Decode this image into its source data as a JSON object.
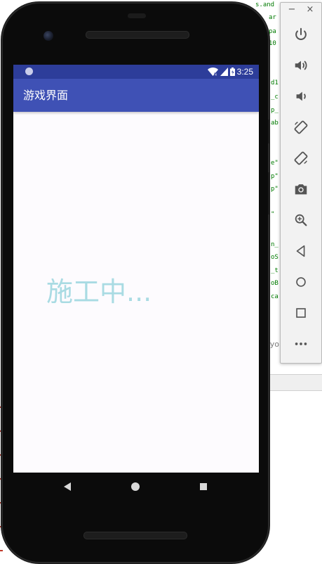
{
  "emulator": {
    "minimize_glyph": "−",
    "close_glyph": "×",
    "tools": [
      {
        "name": "power-icon"
      },
      {
        "name": "volume-up-icon"
      },
      {
        "name": "volume-down-icon"
      },
      {
        "name": "rotate-left-icon"
      },
      {
        "name": "rotate-right-icon"
      },
      {
        "name": "camera-icon"
      },
      {
        "name": "zoom-icon"
      },
      {
        "name": "back-icon"
      },
      {
        "name": "home-icon"
      },
      {
        "name": "overview-icon"
      },
      {
        "name": "more-icon"
      }
    ]
  },
  "status_bar": {
    "time": "3:25",
    "color": "#2d3d9a"
  },
  "app_bar": {
    "title": "游戏界面",
    "color": "#3f51b5"
  },
  "content": {
    "message": "施工中...",
    "message_color": "#a9dbe3"
  },
  "ide_background": {
    "partial_label": "ayo",
    "code_fragments": [
      "s.and",
      "ar",
      "pa",
      "10",
      "d1",
      "_c",
      "p_",
      "ab",
      "e\"",
      "p\"",
      "p\"",
      "\"",
      "n_",
      "oS",
      "_t",
      "oB",
      "ca"
    ]
  }
}
